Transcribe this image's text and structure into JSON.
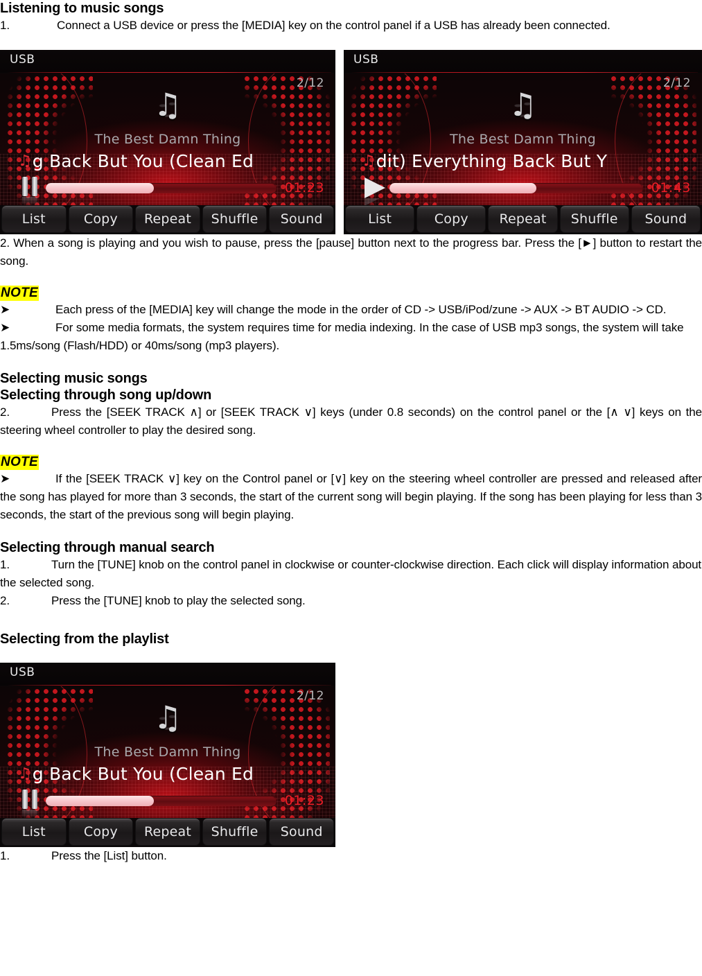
{
  "document": {
    "sections": [
      {
        "heading": "Listening to music songs",
        "paragraphs": [
          {
            "num": "1.",
            "text": "Connect a USB device or press the [MEDIA] key on the control panel if a USB has already been connected."
          }
        ]
      },
      {
        "paragraph_after_images": "2. When a song is playing and you wish to pause, press the [pause] button next to the progress bar. Press the [►] button to restart the song.",
        "note_label": "NOTE",
        "note_items": [
          "Each press of the [MEDIA] key will change the mode in the order of CD -> USB/iPod/zune -> AUX -> BT AUDIO -> CD.",
          "For some media formats, the system requires time for media indexing. In the case of USB mp3 songs, the system will take 1.5ms/song (Flash/HDD) or 40ms/song (mp3 players)."
        ]
      },
      {
        "heading": "Selecting music songs",
        "subheading": "Selecting through song up/down",
        "paragraphs": [
          {
            "num": "2.",
            "text": "Press the [SEEK TRACK  ∧] or [SEEK TRACK  ∨] keys (under 0.8 seconds) on the control panel or the [∧  ∨] keys on the steering wheel controller to play the desired song."
          }
        ],
        "note_label": "NOTE",
        "note_items": [
          "If the [SEEK TRACK  ∨] key on the Control panel or [∨] key on the steering wheel controller are pressed and released after the song has played for more than 3 seconds, the start of the current song will begin playing. If the song has been playing for less than 3 seconds, the start of the previous song will begin playing."
        ]
      },
      {
        "heading": "Selecting through manual search",
        "paragraphs": [
          {
            "num": "1.",
            "text": "Turn the [TUNE] knob on the control panel in clockwise or counter-clockwise direction. Each click will display information about the selected song."
          },
          {
            "num": "2.",
            "text": "Press the [TUNE] knob to play the selected song."
          }
        ]
      },
      {
        "heading": "Selecting from the playlist",
        "paragraph_after_image": {
          "num": "1.",
          "text": "Press the [List] button."
        }
      }
    ]
  },
  "headunit_screens": [
    {
      "id": "screen-paused-left",
      "source": "USB",
      "track_count": "2/12",
      "album": "The Best Damn Thing",
      "title": "g Back But You (Clean Ed",
      "title_icon": "♫",
      "note_icon": "♫",
      "time": "01:23",
      "progress_percent": 47,
      "transport_state": "paused",
      "buttons": [
        "List",
        "Copy",
        "Repeat",
        "Shuffle",
        "Sound"
      ]
    },
    {
      "id": "screen-playing-right",
      "source": "USB",
      "track_count": "2/12",
      "album": "The Best Damn Thing",
      "title": "dit) Everything Back But Y",
      "title_icon": "♫",
      "note_icon": "♫",
      "time": "01:43",
      "progress_percent": 58,
      "transport_state": "playing",
      "buttons": [
        "List",
        "Copy",
        "Repeat",
        "Shuffle",
        "Sound"
      ]
    },
    {
      "id": "screen-playlist-bottom",
      "source": "USB",
      "track_count": "2/12",
      "album": "The Best Damn Thing",
      "title": "g Back But You (Clean Ed",
      "title_icon": "♫",
      "note_icon": "♫",
      "time": "01:23",
      "progress_percent": 47,
      "transport_state": "paused",
      "buttons": [
        "List",
        "Copy",
        "Repeat",
        "Shuffle",
        "Sound"
      ]
    }
  ],
  "colors": {
    "accent_red": "#ee1d26",
    "note_highlight": "#ffff00",
    "screen_bg": "#0a0506"
  }
}
